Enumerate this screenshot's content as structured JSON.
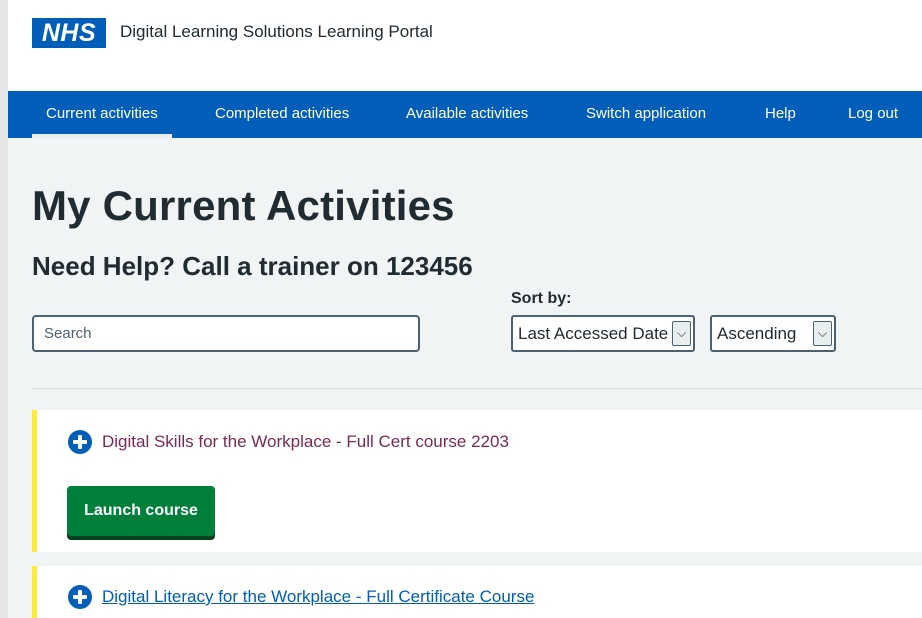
{
  "header": {
    "logo_text": "NHS",
    "service_name": "Digital Learning Solutions Learning Portal"
  },
  "nav": {
    "items": [
      {
        "label": "Current activities",
        "active": true
      },
      {
        "label": "Completed activities",
        "active": false
      },
      {
        "label": "Available activities",
        "active": false
      },
      {
        "label": "Switch application",
        "active": false
      },
      {
        "label": "Help",
        "active": false
      },
      {
        "label": "Log out",
        "active": false
      }
    ]
  },
  "main": {
    "title": "My Current Activities",
    "help_text": "Need Help? Call a trainer on 123456",
    "search": {
      "placeholder": "Search",
      "value": ""
    },
    "sort": {
      "label": "Sort by:",
      "field_selected": "Last Accessed Date",
      "order_selected": "Ascending"
    },
    "courses": [
      {
        "title": "Digital Skills for the Workplace - Full Cert course 2203",
        "expand_icon": "plus-circle-icon",
        "button_label": "Launch course"
      },
      {
        "title": "Digital Literacy for the Workplace - Full Certificate Course",
        "expand_icon": "plus-circle-icon"
      }
    ]
  },
  "colors": {
    "nhs_blue": "#005eb8",
    "background": "#f0f4f5",
    "launch_green": "#007f3b",
    "card_accent": "#ffeb3b",
    "visited_link": "#7c2855"
  }
}
